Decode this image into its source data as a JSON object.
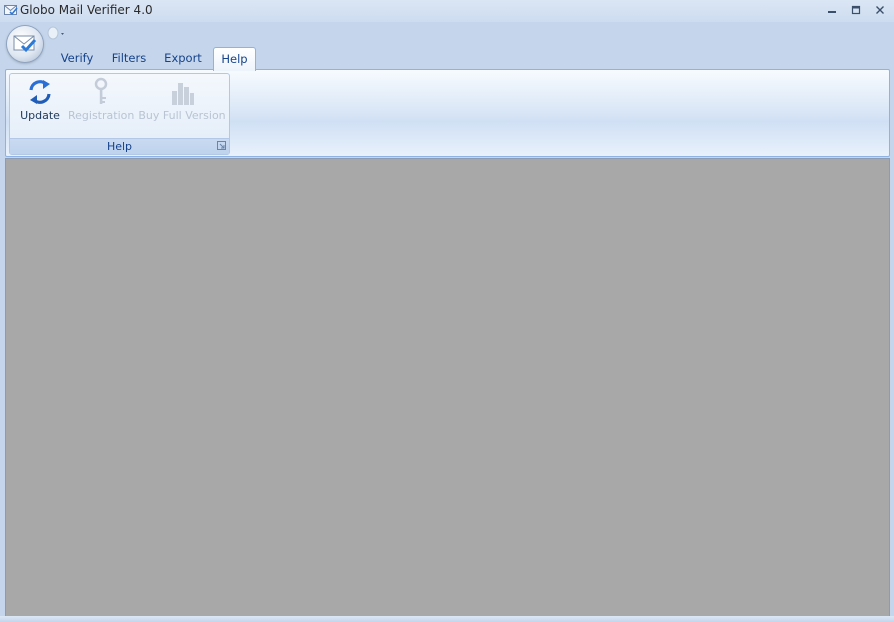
{
  "window": {
    "title": "Globo Mail Verifier 4.0",
    "icon": "envelope-check-icon",
    "controls": [
      "minimize-icon",
      "restore-icon",
      "close-icon"
    ]
  },
  "ribbon": {
    "tabs": [
      {
        "label": "Verify",
        "active": false
      },
      {
        "label": "Filters",
        "active": false
      },
      {
        "label": "Export",
        "active": false
      },
      {
        "label": "Help",
        "active": true
      }
    ],
    "groups": [
      {
        "label": "Help",
        "buttons": [
          {
            "label": "Update",
            "icon": "refresh-arrows-icon",
            "enabled": true
          },
          {
            "label": "Registration",
            "icon": "key-icon",
            "enabled": false
          },
          {
            "label": "Buy Full Version",
            "icon": "buy-icon",
            "enabled": false
          }
        ]
      }
    ]
  },
  "colors": {
    "frame": "#c5d6ec",
    "ribbon_border": "#8db2e3",
    "tab_text": "#15428b",
    "workspace": "#a8a8a8",
    "update_icon": "#2a6fd6"
  }
}
